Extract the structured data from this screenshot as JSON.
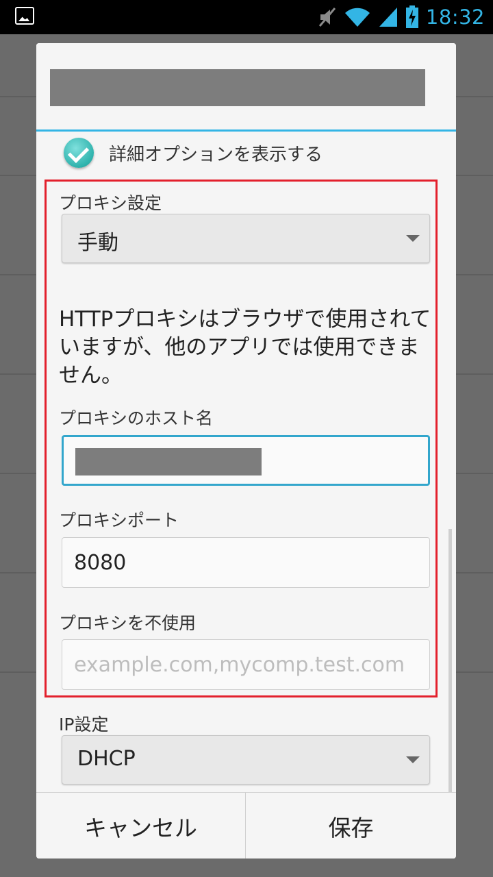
{
  "status_bar": {
    "time": "18:32"
  },
  "dialog": {
    "advanced_options_label": "詳細オプションを表示する",
    "proxy_settings_label": "プロキシ設定",
    "proxy_settings_value": "手動",
    "proxy_message": "HTTPプロキシはブラウザで使用されていますが、他のアプリでは使用できません。",
    "proxy_host_label": "プロキシのホスト名",
    "proxy_port_label": "プロキシポート",
    "proxy_port_value": "8080",
    "proxy_bypass_label": "プロキシを不使用",
    "proxy_bypass_placeholder": "example.com,mycomp.test.com",
    "ip_settings_label": "IP設定",
    "ip_settings_value": "DHCP",
    "cancel_label": "キャンセル",
    "save_label": "保存"
  },
  "colors": {
    "accent": "#33b5e5",
    "highlight": "#e3202c",
    "checkbox": "#2fb3ad"
  }
}
